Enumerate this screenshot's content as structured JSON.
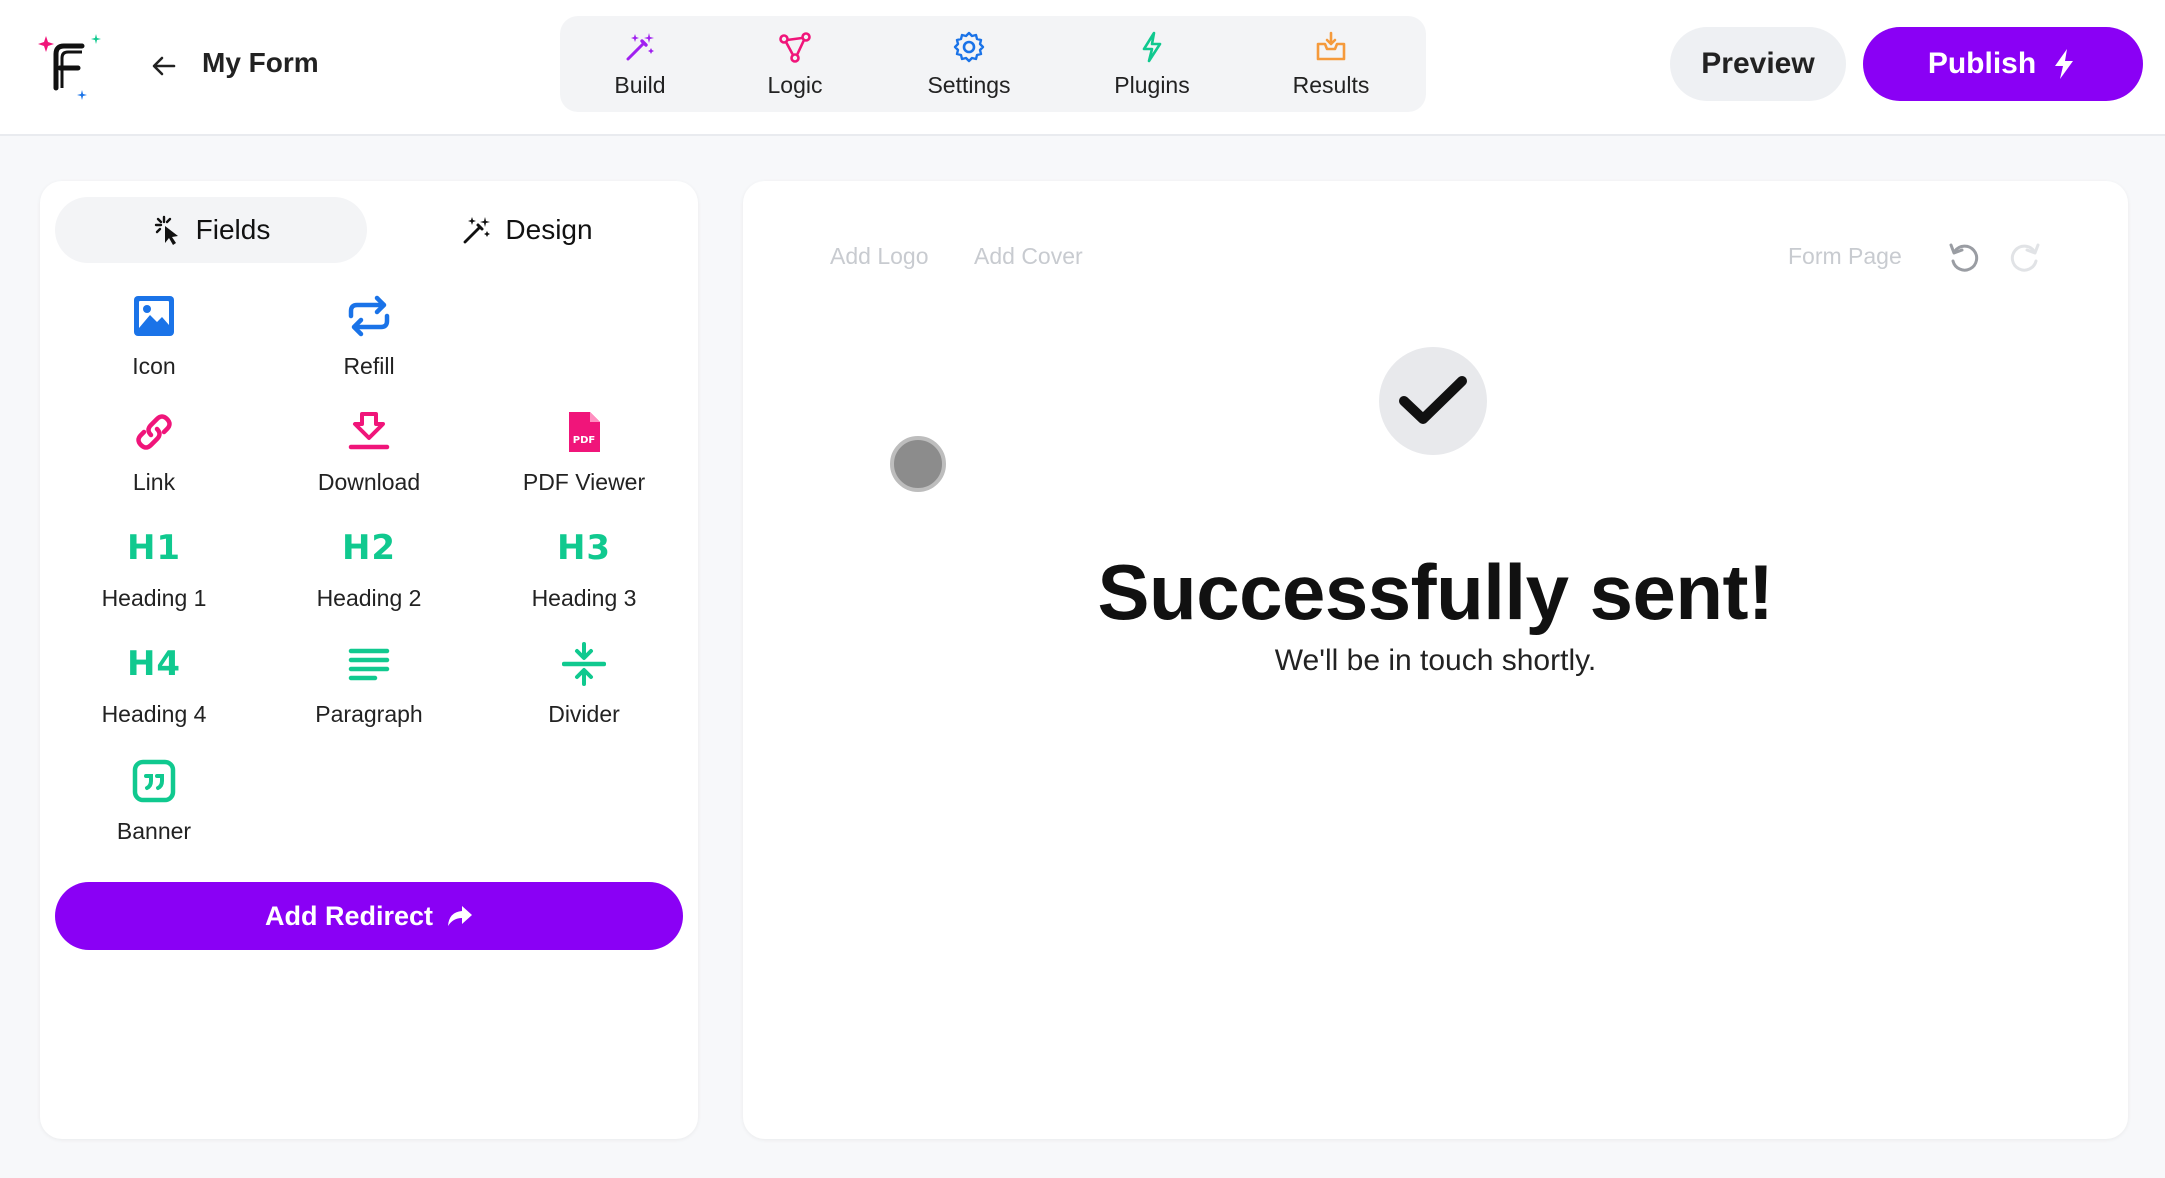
{
  "header": {
    "form_name": "My Form",
    "nav": [
      {
        "label": "Build",
        "icon": "magic-wand-icon",
        "color": "#a020f0"
      },
      {
        "label": "Logic",
        "icon": "logic-nodes-icon",
        "color": "#f0157a"
      },
      {
        "label": "Settings",
        "icon": "gear-icon",
        "color": "#1a73e8"
      },
      {
        "label": "Plugins",
        "icon": "lightning-icon",
        "color": "#10c98f"
      },
      {
        "label": "Results",
        "icon": "inbox-icon",
        "color": "#f59a3b"
      }
    ],
    "preview_label": "Preview",
    "publish_label": "Publish"
  },
  "sidebar": {
    "tabs": [
      {
        "label": "Fields",
        "active": true
      },
      {
        "label": "Design",
        "active": false
      }
    ],
    "fields": [
      {
        "label": "Icon",
        "icon": "image-icon"
      },
      {
        "label": "Refill",
        "icon": "repeat-icon"
      },
      {
        "label": "Link",
        "icon": "link-icon"
      },
      {
        "label": "Download",
        "icon": "download-icon"
      },
      {
        "label": "PDF Viewer",
        "icon": "pdf-icon",
        "glyph": "PDF"
      },
      {
        "label": "Heading 1",
        "glyph": "H1"
      },
      {
        "label": "Heading 2",
        "glyph": "H2"
      },
      {
        "label": "Heading 3",
        "glyph": "H3"
      },
      {
        "label": "Heading 4",
        "glyph": "H4"
      },
      {
        "label": "Paragraph",
        "icon": "paragraph-icon"
      },
      {
        "label": "Divider",
        "icon": "divider-icon"
      },
      {
        "label": "Banner",
        "icon": "quote-banner-icon"
      }
    ],
    "redirect_label": "Add Redirect"
  },
  "canvas": {
    "add_logo": "Add Logo",
    "add_cover": "Add Cover",
    "form_page": "Form Page",
    "title": "Successfully sent!",
    "subtitle": "We'll be in touch shortly."
  },
  "colors": {
    "accent": "#8a00f5",
    "blue": "#1a73e8",
    "pink": "#f0157a",
    "green": "#10c98f"
  }
}
